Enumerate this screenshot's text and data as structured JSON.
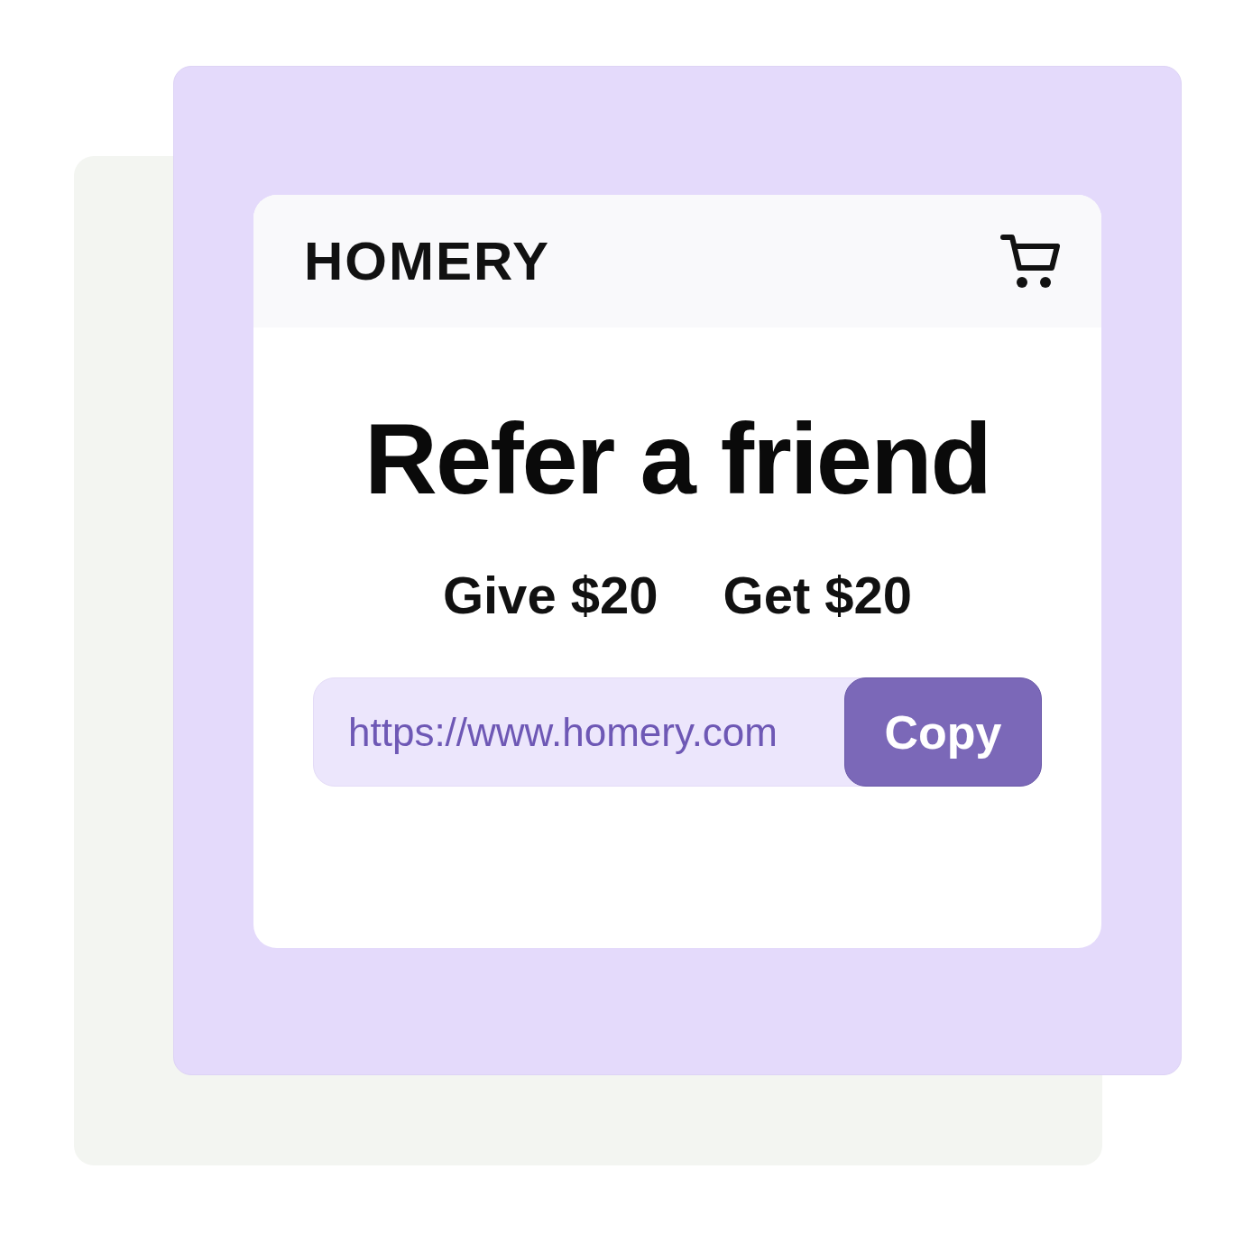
{
  "brand": "HOMERY",
  "heading": "Refer a friend",
  "offers": [
    "Give $20",
    "Get $20"
  ],
  "referral": {
    "url": "https://www.homery.com",
    "button": "Copy"
  }
}
